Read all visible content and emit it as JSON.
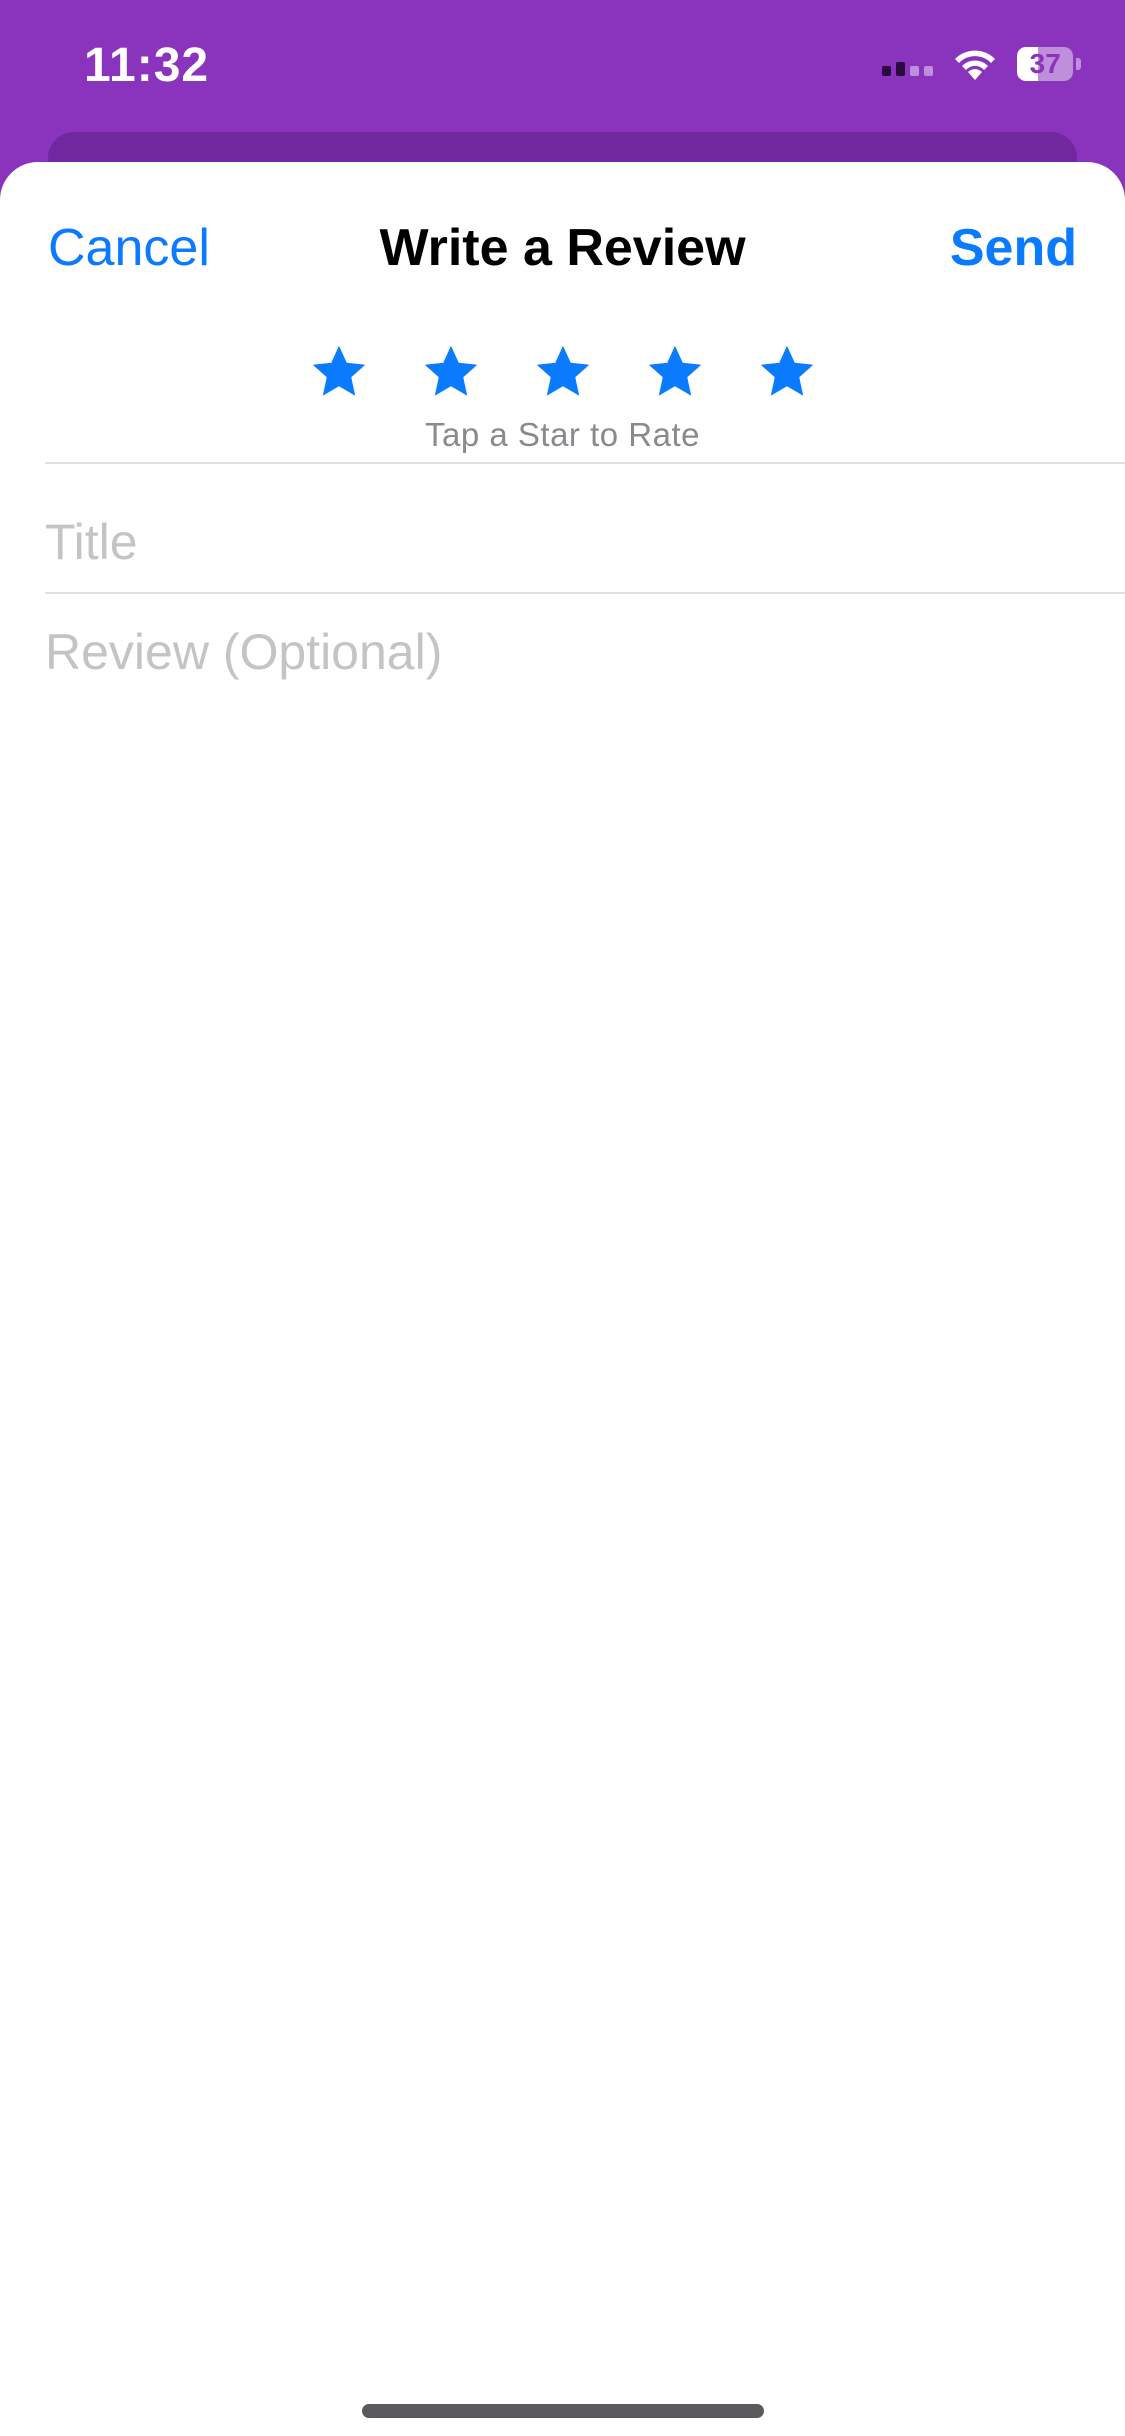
{
  "status_bar": {
    "time": "11:32",
    "battery": "37",
    "battery_level_percent": 37,
    "icons": [
      "cellular-signal-icon",
      "wifi-icon",
      "battery-icon"
    ]
  },
  "nav": {
    "cancel_label": "Cancel",
    "title": "Write a Review",
    "send_label": "Send"
  },
  "rating": {
    "star_count": 5,
    "selected": 0,
    "caption": "Tap a Star to Rate"
  },
  "form": {
    "title_placeholder": "Title",
    "title_value": "",
    "review_placeholder": "Review (Optional)",
    "review_value": ""
  },
  "colors": {
    "accent": "#0a7aff",
    "background_behind_sheet": "#8a34bd",
    "placeholder": "#c4c4c7",
    "caption": "#8a8a8e"
  }
}
